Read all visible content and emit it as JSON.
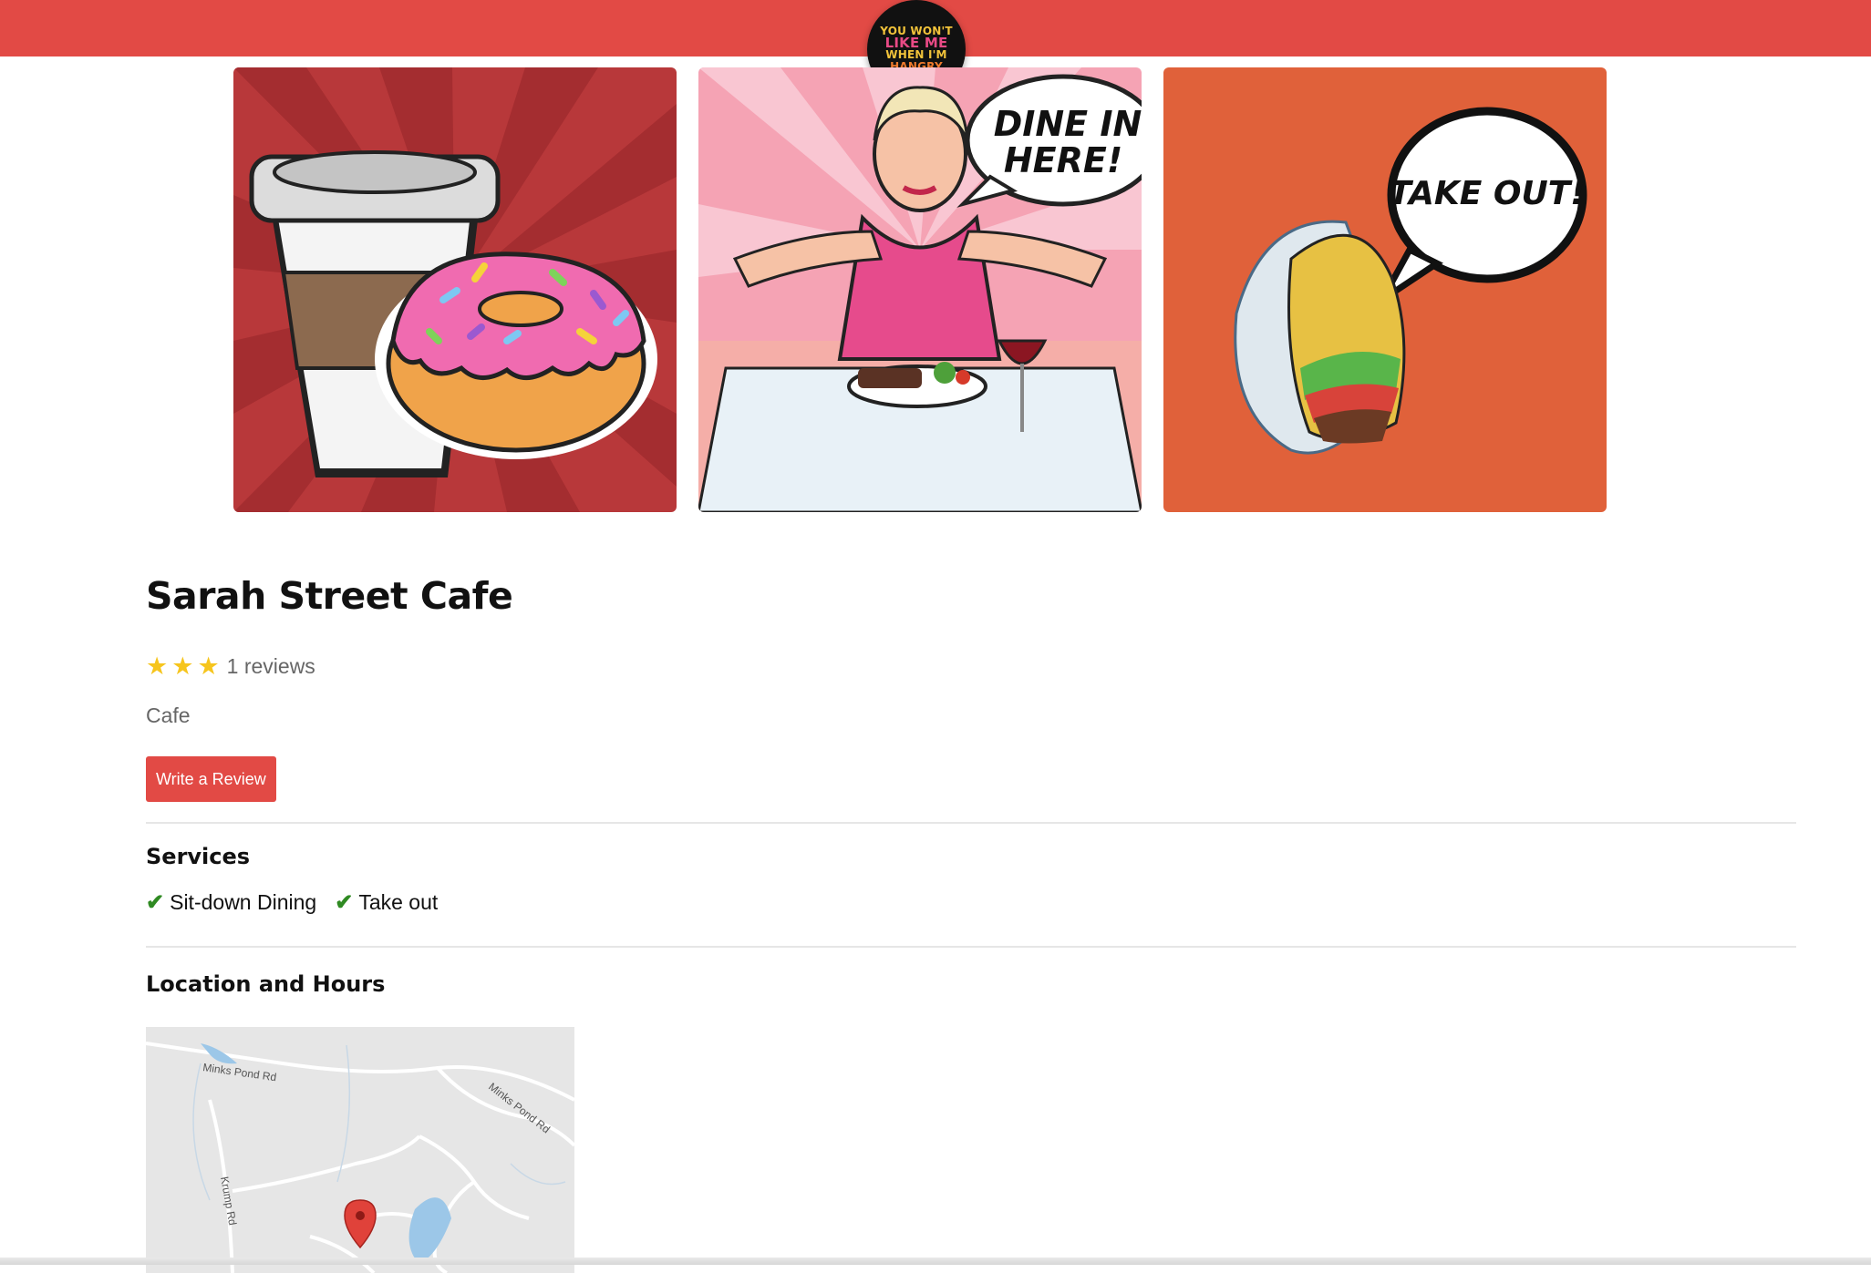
{
  "logo": {
    "lines": [
      "YOU WON'T",
      "LIKE ME",
      "WHEN I'M",
      "HANGRY"
    ]
  },
  "hero": {
    "tiles": [
      {
        "caption": ""
      },
      {
        "caption": "DINE IN HERE!"
      },
      {
        "caption": "TAKE OUT!"
      }
    ]
  },
  "business": {
    "name": "Sarah Street Cafe",
    "stars": 3,
    "reviews_label": "1 reviews",
    "category": "Cafe",
    "review_button": "Write a Review"
  },
  "services": {
    "heading": "Services",
    "items": [
      "Sit-down Dining",
      "Take out"
    ]
  },
  "location": {
    "heading": "Location and Hours",
    "map_labels": [
      "Minks Pond Rd",
      "Minks Pond Rd",
      "Krump Rd"
    ]
  },
  "colors": {
    "brand": "#e24a45",
    "check": "#2f8a22",
    "star": "#f6c51d"
  }
}
